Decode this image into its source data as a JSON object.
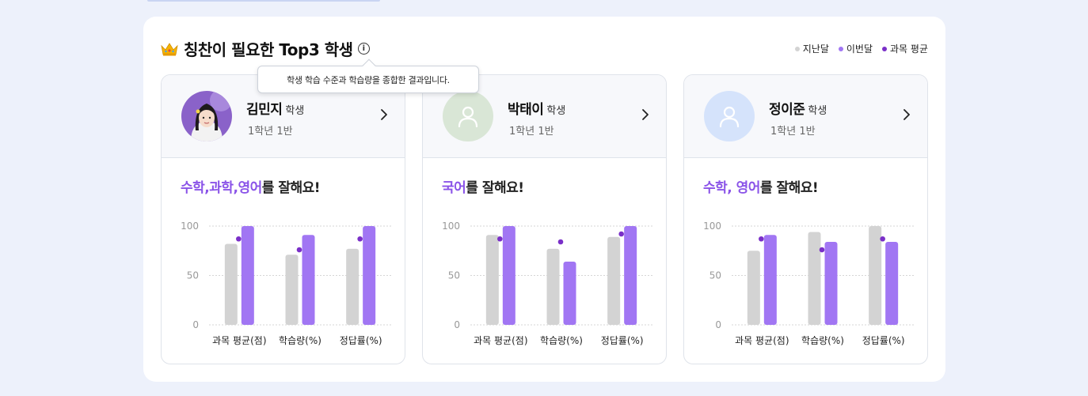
{
  "header": {
    "title": "칭찬이 필요한 Top3 학생",
    "info_symbol": "i",
    "tooltip": "학생 학습 수준과 학습량을 종합한 결과입니다."
  },
  "legend": [
    {
      "label": "지난달",
      "color": "#d3d3d3"
    },
    {
      "label": "이번달",
      "color": "#a176f3"
    },
    {
      "label": "과목 평균",
      "color": "#7a2fc8"
    }
  ],
  "students": [
    {
      "name": "김민지",
      "suffix": "학생",
      "class": "1학년 1반",
      "avatar": "photo",
      "praise_highlight": "수학,과학,영어",
      "praise_rest": "를 잘해요!"
    },
    {
      "name": "박태이",
      "suffix": "학생",
      "class": "1학년 1반",
      "avatar": "default-green",
      "praise_highlight": "국어",
      "praise_rest": "를 잘해요!"
    },
    {
      "name": "정이준",
      "suffix": "학생",
      "class": "1학년 1반",
      "avatar": "default-blue",
      "praise_highlight": "수학, 영어",
      "praise_rest": "를 잘해요!"
    }
  ],
  "avatar_colors": {
    "default-green": "#d9e6d6",
    "default-blue": "#d5e3fb"
  },
  "chart_data": [
    {
      "type": "bar",
      "categories": [
        "과목 평균(점)",
        "학습량(%)",
        "정답률(%)"
      ],
      "ylim": [
        0,
        100
      ],
      "yticks": [
        0,
        50,
        100
      ],
      "series": [
        {
          "name": "지난달",
          "values": [
            82,
            71,
            77
          ]
        },
        {
          "name": "이번달",
          "values": [
            100,
            91,
            100
          ]
        },
        {
          "name": "과목 평균",
          "values": [
            87,
            76,
            87
          ]
        }
      ]
    },
    {
      "type": "bar",
      "categories": [
        "과목 평균(점)",
        "학습량(%)",
        "정답률(%)"
      ],
      "ylim": [
        0,
        100
      ],
      "yticks": [
        0,
        50,
        100
      ],
      "series": [
        {
          "name": "지난달",
          "values": [
            91,
            77,
            89
          ]
        },
        {
          "name": "이번달",
          "values": [
            100,
            64,
            100
          ]
        },
        {
          "name": "과목 평균",
          "values": [
            87,
            84,
            92
          ]
        }
      ]
    },
    {
      "type": "bar",
      "categories": [
        "과목 평균(점)",
        "학습량(%)",
        "정답률(%)"
      ],
      "ylim": [
        0,
        100
      ],
      "yticks": [
        0,
        50,
        100
      ],
      "series": [
        {
          "name": "지난달",
          "values": [
            75,
            94,
            100
          ]
        },
        {
          "name": "이번달",
          "values": [
            91,
            84,
            84
          ]
        },
        {
          "name": "과목 평균",
          "values": [
            87,
            76,
            87
          ]
        }
      ]
    }
  ]
}
